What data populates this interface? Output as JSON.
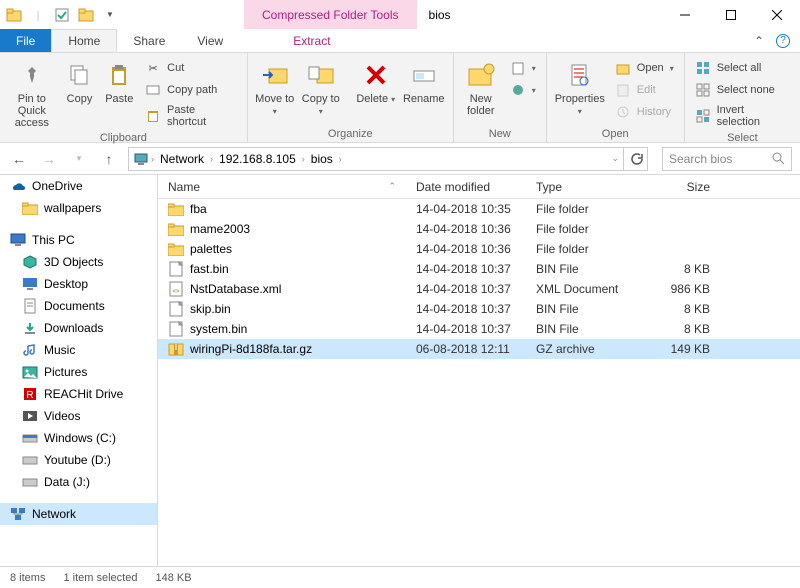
{
  "titlebar": {
    "context_tools": "Compressed Folder Tools",
    "title": "bios"
  },
  "tabs": {
    "file": "File",
    "home": "Home",
    "share": "Share",
    "view": "View",
    "extract": "Extract"
  },
  "ribbon": {
    "clipboard": {
      "label": "Clipboard",
      "pin": "Pin to Quick access",
      "copy": "Copy",
      "paste": "Paste",
      "cut": "Cut",
      "copypath": "Copy path",
      "pasteshortcut": "Paste shortcut"
    },
    "organize": {
      "label": "Organize",
      "moveto": "Move to",
      "copyto": "Copy to",
      "delete": "Delete",
      "rename": "Rename"
    },
    "new": {
      "label": "New",
      "newfolder": "New folder"
    },
    "open": {
      "label": "Open",
      "properties": "Properties",
      "open": "Open",
      "edit": "Edit",
      "history": "History"
    },
    "select": {
      "label": "Select",
      "selectall": "Select all",
      "selectnone": "Select none",
      "invert": "Invert selection"
    }
  },
  "breadcrumbs": [
    "Network",
    "192.168.8.105",
    "bios"
  ],
  "search_placeholder": "Search bios",
  "sidebar": {
    "onedrive": "OneDrive",
    "wallpapers": "wallpapers",
    "thispc": "This PC",
    "objects3d": "3D Objects",
    "desktop": "Desktop",
    "documents": "Documents",
    "downloads": "Downloads",
    "music": "Music",
    "pictures": "Pictures",
    "reachit": "REACHit Drive",
    "videos": "Videos",
    "cdrive": "Windows (C:)",
    "ddrive": "Youtube (D:)",
    "jdrive": "Data (J:)",
    "network": "Network"
  },
  "columns": {
    "name": "Name",
    "date": "Date modified",
    "type": "Type",
    "size": "Size"
  },
  "files": [
    {
      "name": "fba",
      "date": "14-04-2018 10:35",
      "type": "File folder",
      "size": "",
      "kind": "folder"
    },
    {
      "name": "mame2003",
      "date": "14-04-2018 10:36",
      "type": "File folder",
      "size": "",
      "kind": "folder"
    },
    {
      "name": "palettes",
      "date": "14-04-2018 10:36",
      "type": "File folder",
      "size": "",
      "kind": "folder"
    },
    {
      "name": "fast.bin",
      "date": "14-04-2018 10:37",
      "type": "BIN File",
      "size": "8 KB",
      "kind": "bin"
    },
    {
      "name": "NstDatabase.xml",
      "date": "14-04-2018 10:37",
      "type": "XML Document",
      "size": "986 KB",
      "kind": "xml"
    },
    {
      "name": "skip.bin",
      "date": "14-04-2018 10:37",
      "type": "BIN File",
      "size": "8 KB",
      "kind": "bin"
    },
    {
      "name": "system.bin",
      "date": "14-04-2018 10:37",
      "type": "BIN File",
      "size": "8 KB",
      "kind": "bin"
    },
    {
      "name": "wiringPi-8d188fa.tar.gz",
      "date": "06-08-2018 12:11",
      "type": "GZ archive",
      "size": "149 KB",
      "kind": "gz",
      "selected": true
    }
  ],
  "status": {
    "items": "8 items",
    "selected": "1 item selected",
    "size": "148 KB"
  }
}
